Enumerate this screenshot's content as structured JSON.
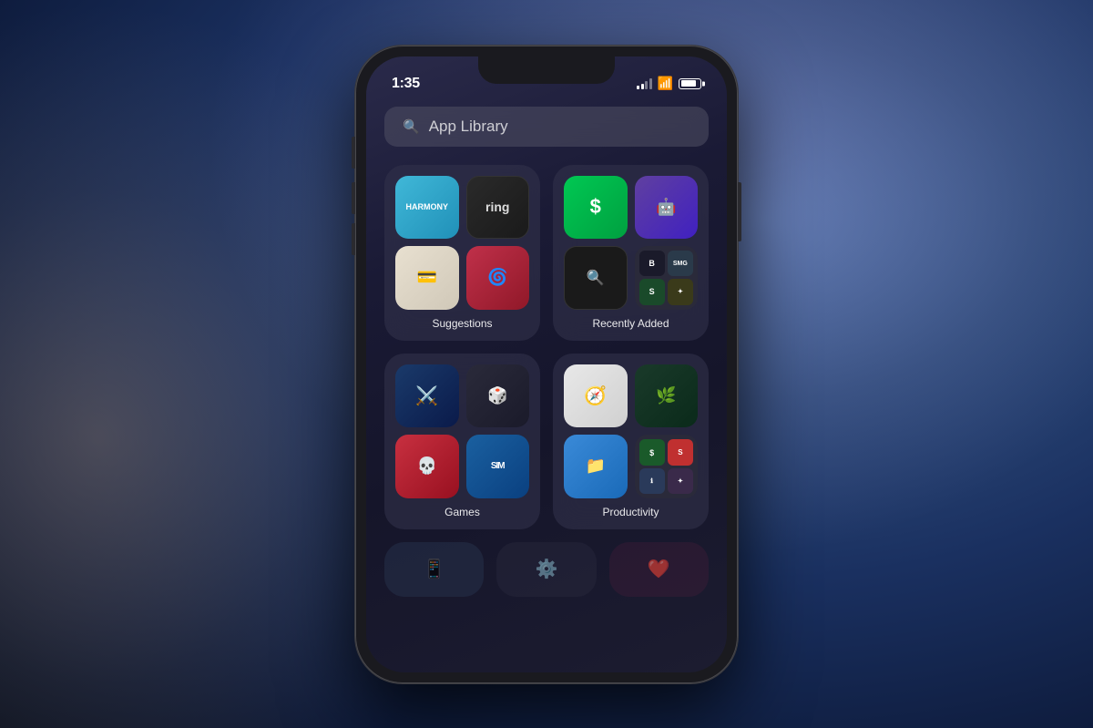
{
  "background": {
    "color_start": "#2d4a7a",
    "color_end": "#0d1a3a"
  },
  "phone": {
    "status_bar": {
      "time": "1:35",
      "signal_label": "signal",
      "wifi_label": "wifi",
      "battery_label": "battery"
    },
    "search_bar": {
      "placeholder": "App Library",
      "icon": "search"
    },
    "groups": [
      {
        "id": "suggestions",
        "label": "Suggestions",
        "apps": [
          {
            "id": "harmony",
            "name": "Harmony",
            "color_class": "app-harmony"
          },
          {
            "id": "ring",
            "name": "Ring",
            "color_class": "app-ring"
          },
          {
            "id": "wallet",
            "name": "Wallet",
            "color_class": "app-wallet"
          },
          {
            "id": "nova",
            "name": "Nova Launcher",
            "color_class": "app-nova"
          }
        ]
      },
      {
        "id": "recently-added",
        "label": "Recently Added",
        "apps": [
          {
            "id": "cashapp",
            "name": "Cash App",
            "color_class": "app-cashapp"
          },
          {
            "id": "robot",
            "name": "Bot App",
            "color_class": "app-robot"
          },
          {
            "id": "magnify",
            "name": "Magnify",
            "color_class": "app-magnify"
          },
          {
            "id": "mini-group",
            "name": "More",
            "color_class": ""
          }
        ]
      },
      {
        "id": "games",
        "label": "Games",
        "apps": [
          {
            "id": "ffta",
            "name": "Final Fantasy",
            "color_class": "app-ffta"
          },
          {
            "id": "dice",
            "name": "Dice App",
            "color_class": "app-dice"
          },
          {
            "id": "skullgirls",
            "name": "Skullgirls",
            "color_class": "app-skullgirls"
          },
          {
            "id": "simcity",
            "name": "SimCity",
            "color_class": "app-simcity"
          }
        ]
      },
      {
        "id": "productivity",
        "label": "Productivity",
        "apps": [
          {
            "id": "safari",
            "name": "Safari",
            "color_class": "app-safari"
          },
          {
            "id": "robinhood",
            "name": "Robinhood",
            "color_class": "app-robinhood"
          },
          {
            "id": "files",
            "name": "Files",
            "color_class": "app-files"
          },
          {
            "id": "mini-group2",
            "name": "More",
            "color_class": ""
          }
        ]
      }
    ]
  }
}
